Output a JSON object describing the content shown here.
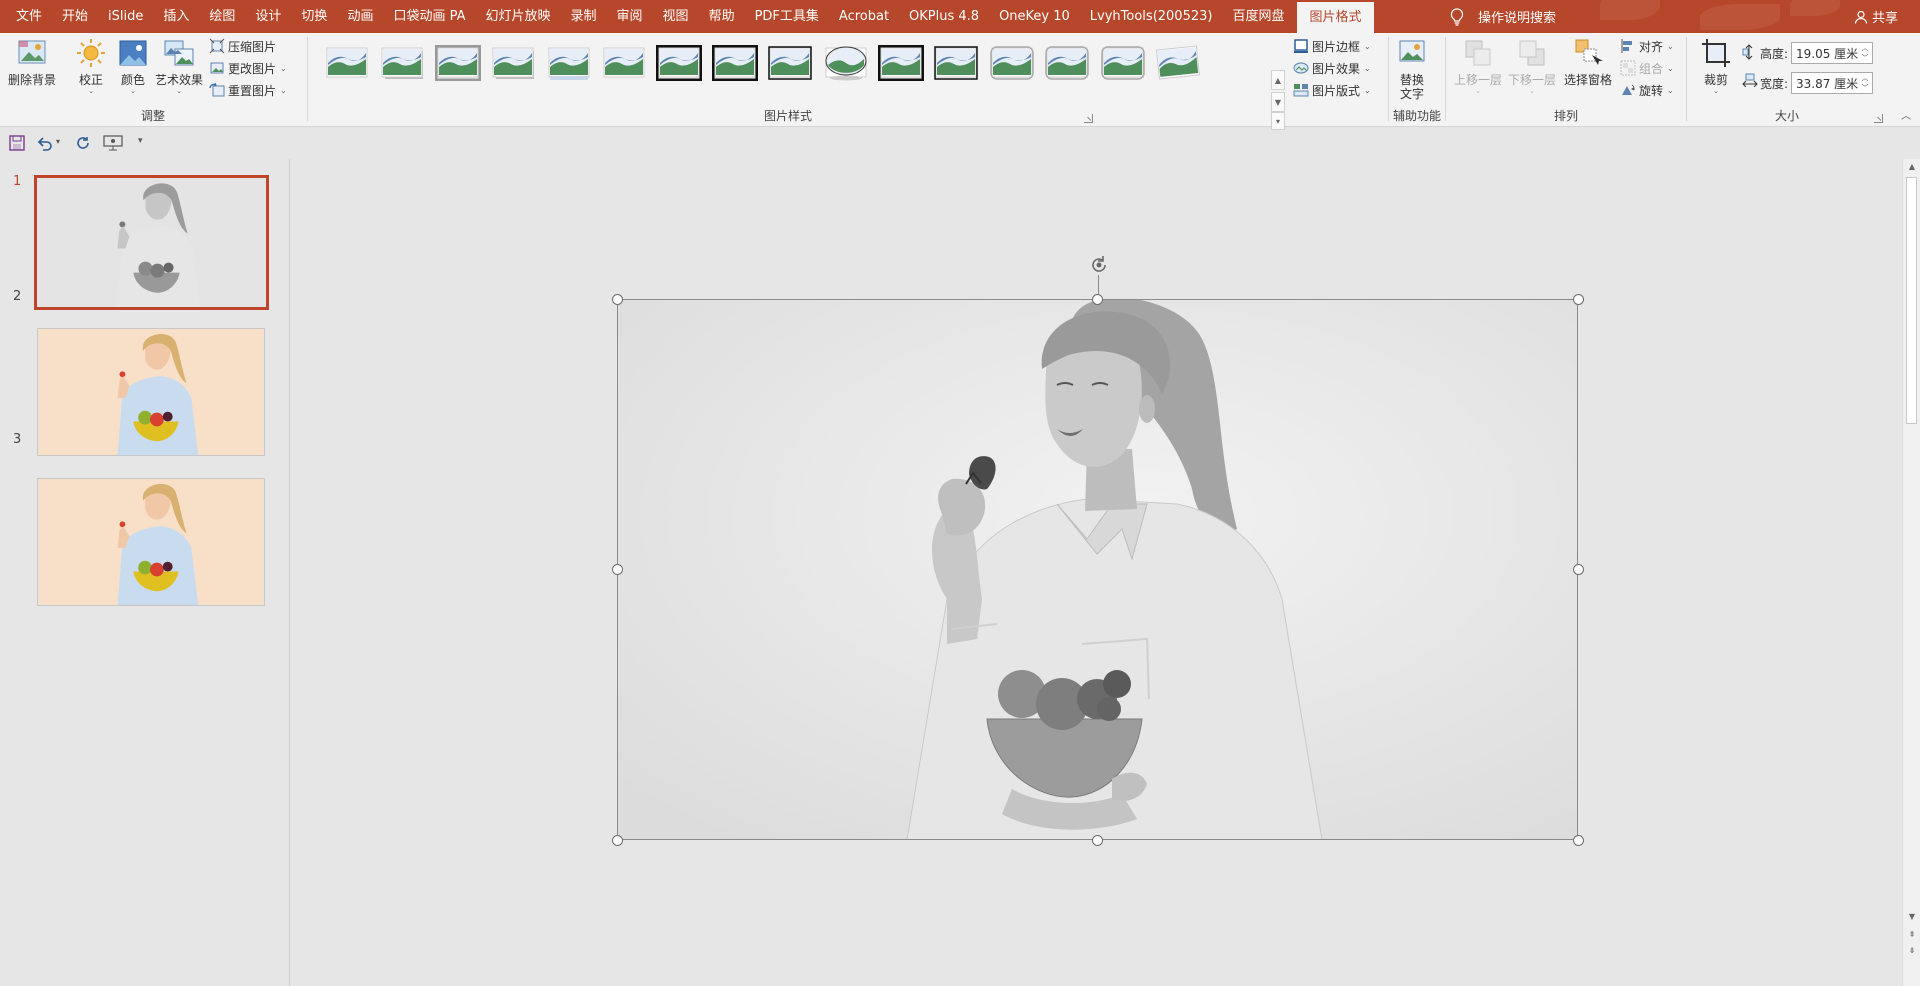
{
  "tabs": [
    {
      "label": "文件",
      "active": false
    },
    {
      "label": "开始",
      "active": false
    },
    {
      "label": "iSlide",
      "active": false
    },
    {
      "label": "插入",
      "active": false
    },
    {
      "label": "绘图",
      "active": false
    },
    {
      "label": "设计",
      "active": false
    },
    {
      "label": "切换",
      "active": false
    },
    {
      "label": "动画",
      "active": false
    },
    {
      "label": "口袋动画 PA",
      "active": false
    },
    {
      "label": "幻灯片放映",
      "active": false
    },
    {
      "label": "录制",
      "active": false
    },
    {
      "label": "审阅",
      "active": false
    },
    {
      "label": "视图",
      "active": false
    },
    {
      "label": "帮助",
      "active": false
    },
    {
      "label": "PDF工具集",
      "active": false
    },
    {
      "label": "Acrobat",
      "active": false
    },
    {
      "label": "OKPlus 4.8",
      "active": false
    },
    {
      "label": "OneKey 10",
      "active": false
    },
    {
      "label": "LvyhTools(200523)",
      "active": false
    },
    {
      "label": "百度网盘",
      "active": false
    },
    {
      "label": "图片格式",
      "active": true
    }
  ],
  "tell_me": "操作说明搜索",
  "share": "共享",
  "ribbon": {
    "adjust": {
      "label": "调整",
      "remove_bg": "删除背景",
      "corrections": "校正",
      "color": "颜色",
      "artistic": "艺术效果",
      "compress": "压缩图片",
      "change": "更改图片",
      "reset": "重置图片"
    },
    "styles": {
      "label": "图片样式",
      "border": "图片边框",
      "effects": "图片效果",
      "layout": "图片版式"
    },
    "accessibility": {
      "label": "辅助功能",
      "alt_text": "替换文字"
    },
    "arrange": {
      "label": "排列",
      "bring_forward": "上移一层",
      "send_backward": "下移一层",
      "selection_pane": "选择窗格",
      "align": "对齐",
      "group": "组合",
      "rotate": "旋转"
    },
    "size": {
      "label": "大小",
      "crop": "裁剪",
      "height_label": "高度:",
      "height_value": "19.05 厘米",
      "width_label": "宽度:",
      "width_value": "33.87 厘米"
    }
  },
  "slides": [
    {
      "number": "1",
      "active": true,
      "grayscale": true
    },
    {
      "number": "2",
      "active": false,
      "grayscale": false
    },
    {
      "number": "3",
      "active": false,
      "grayscale": false
    }
  ],
  "colors": {
    "accent": "#b7472a",
    "ribbon_bg": "#f3f3f3",
    "workspace": "#e6e6e6",
    "selected_thumb_border": "#c0442a"
  }
}
